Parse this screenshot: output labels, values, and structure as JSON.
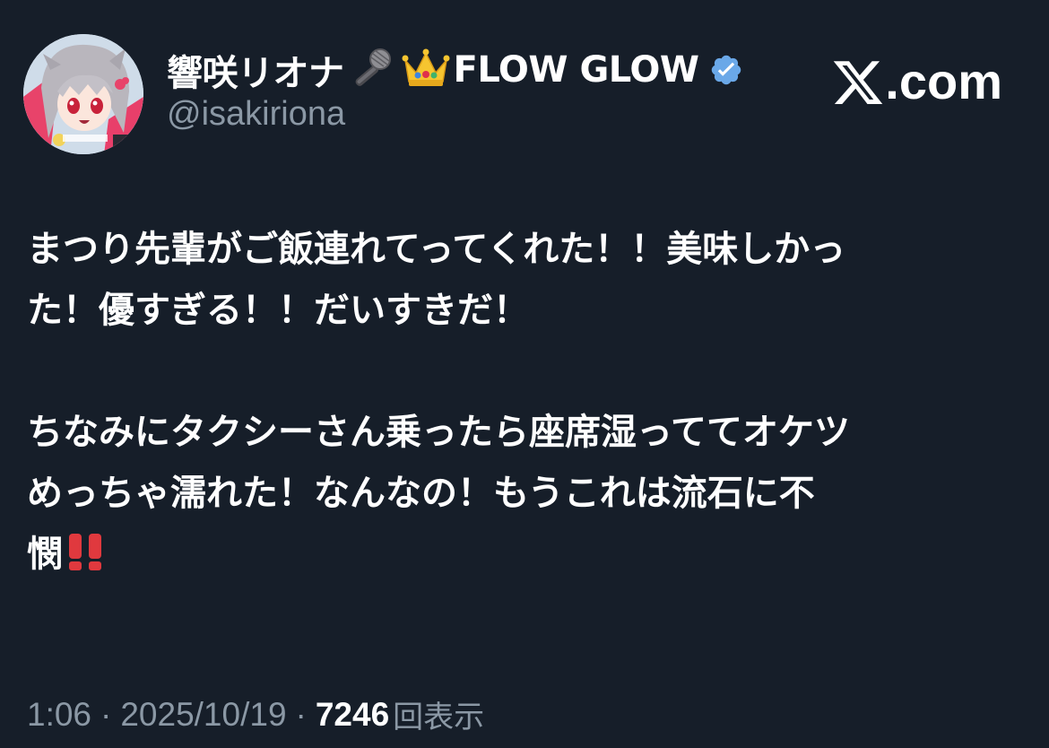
{
  "author": {
    "display_name": "響咲リオナ",
    "name_suffix": "FLOW GLOW",
    "handle": "@isakiriona",
    "name_emojis": [
      "microphone-icon",
      "crown-icon"
    ],
    "verified": true,
    "verified_color": "#6aa8e8"
  },
  "site_label": ".com",
  "tweet": {
    "paragraphs": [
      {
        "lines": [
          "まつり先輩がご飯連れてってくれた！！美味しかっ",
          "た！優すぎる！！だいすきだ！"
        ]
      },
      {
        "lines": [
          "ちなみにタクシーさん乗ったら座席湿っててオケツ",
          "めっちゃ濡れた！なんなの！もうこれは流石に不",
          "憫"
        ],
        "trailing_emoji": "double-exclamation-icon",
        "trailing_emoji_color": "#e0393e"
      }
    ]
  },
  "footer": {
    "time": "1:06",
    "separator": "·",
    "date": "2025/10/19",
    "views_count": "7246",
    "views_label": "回表示"
  },
  "colors": {
    "background": "#161e29",
    "primary_text": "#ffffff",
    "secondary_text": "#8b98a5"
  }
}
